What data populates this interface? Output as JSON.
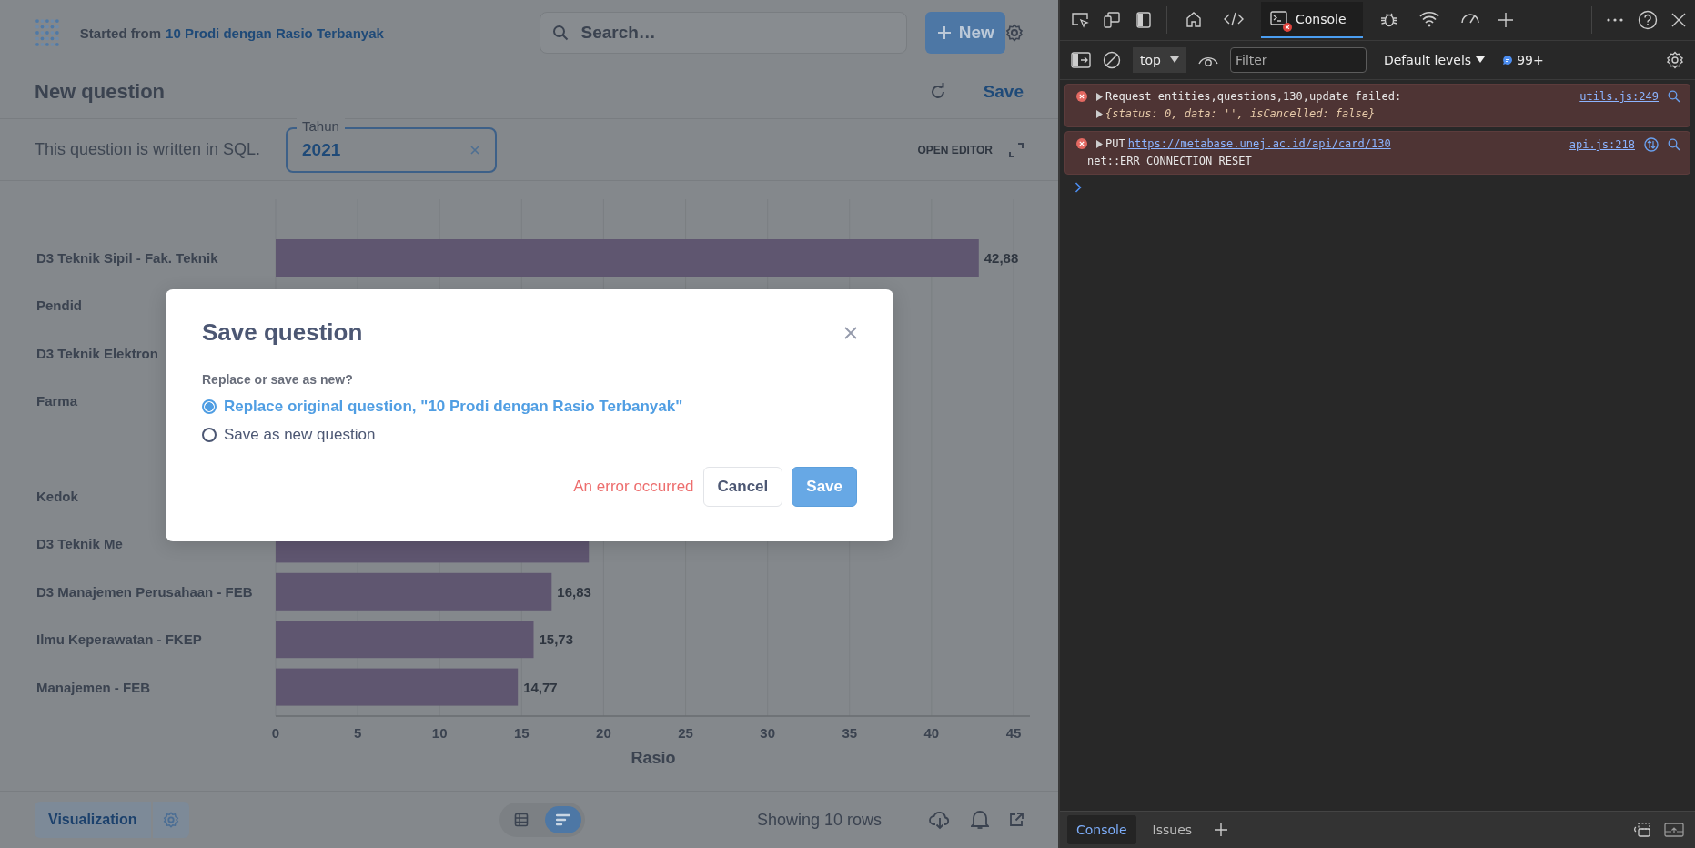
{
  "app": {
    "header": {
      "breadcrumb_prefix": "Started from",
      "breadcrumb_link": "10 Prodi dengan Rasio Terbanyak",
      "search": {
        "placeholder": "Search…"
      },
      "new_button": "New"
    },
    "title": "New question",
    "save": "Save",
    "filter_bar": {
      "note": "This question is written in SQL.",
      "filter": {
        "label": "Tahun",
        "value": "2021"
      },
      "open_editor": "OPEN EDITOR"
    },
    "chart": {
      "chart_data": {
        "type": "bar",
        "orientation": "horizontal",
        "xlabel": "Rasio",
        "categories": [
          "D3 Teknik Sipil - Fak. Teknik",
          "Pendid",
          "D3 Teknik Elektron",
          "Farma",
          null,
          "Kedok",
          "D3 Teknik Me",
          "D3 Manajemen Perusahaan - FEB",
          "Ilmu Keperawatan - FKEP",
          "Manajemen - FEB"
        ],
        "grid": true,
        "values": [
          42.88,
          null,
          null,
          null,
          null,
          null,
          19.1,
          16.83,
          15.73,
          14.77
        ],
        "value_labels": [
          "42,88",
          null,
          null,
          null,
          null,
          null,
          null,
          "16,83",
          "15,73",
          "14,77"
        ],
        "xlim": [
          0,
          46
        ],
        "xticks": [
          0,
          5,
          10,
          15,
          20,
          25,
          30,
          35,
          40,
          45
        ]
      }
    },
    "footer": {
      "visualization": "Visualization",
      "views": [
        {
          "kind": "table",
          "selected": false
        },
        {
          "kind": "chart",
          "selected": true
        }
      ],
      "row_count": "Showing 10 rows"
    }
  },
  "dialog": {
    "title": "Save question",
    "prompt": "Replace or save as new?",
    "options": [
      {
        "label": "Replace original question, \"10 Prodi dengan Rasio Terbanyak\"",
        "selected": true
      },
      {
        "label": "Save as new question",
        "selected": false
      }
    ],
    "error": "An error occurred",
    "buttons": [
      {
        "kind": "secondary",
        "label": "Cancel"
      },
      {
        "kind": "primary",
        "label": "Save"
      }
    ]
  },
  "devtools": {
    "tabs": [
      {
        "kind": "home",
        "selected": false
      },
      {
        "kind": "elements",
        "selected": false
      },
      {
        "kind": "console",
        "label": "Console",
        "selected": true,
        "error_badge": true
      },
      {
        "kind": "sources",
        "selected": false
      },
      {
        "kind": "network",
        "selected": false
      },
      {
        "kind": "performance",
        "selected": false
      }
    ],
    "toolbar": {
      "context": "top",
      "filter": {
        "placeholder": "Filter"
      },
      "levels": "Default levels",
      "message_count": "99+"
    },
    "messages": [
      {
        "kind": "log",
        "error": true,
        "text": "Request entities,questions,130,update failed:",
        "detail": "{status: 0, data: '', isCancelled: false}",
        "source": "utils.js:249"
      },
      {
        "kind": "request",
        "error": true,
        "method": "PUT",
        "url": "https://metabase.unej.ac.id/api/card/130",
        "detail": "net::ERR_CONNECTION_RESET",
        "source": "api.js:218"
      }
    ],
    "drawer_tabs": [
      {
        "label": "Console",
        "selected": true
      },
      {
        "label": "Issues",
        "selected": false
      }
    ]
  }
}
